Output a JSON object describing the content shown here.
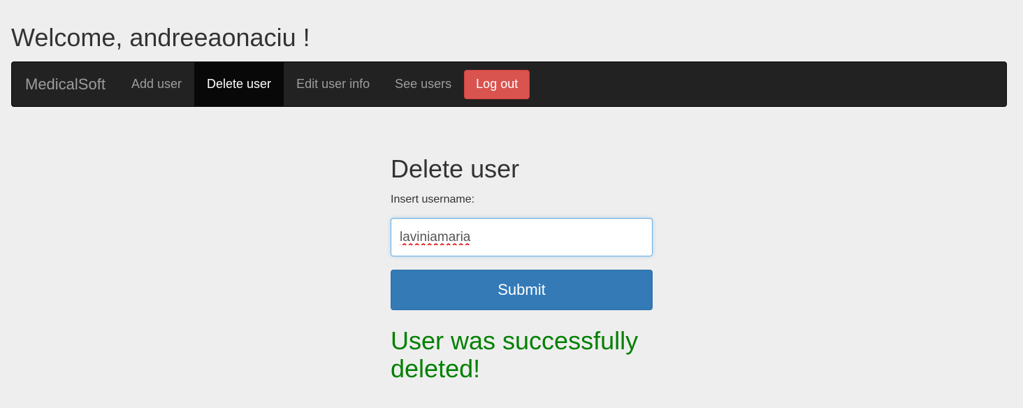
{
  "header": {
    "welcome_text": "Welcome, andreeaonaciu !"
  },
  "navbar": {
    "brand": "MedicalSoft",
    "items": [
      {
        "label": "Add user",
        "active": false
      },
      {
        "label": "Delete user",
        "active": true
      },
      {
        "label": "Edit user info",
        "active": false
      },
      {
        "label": "See users",
        "active": false
      }
    ],
    "logout_label": "Log out"
  },
  "form": {
    "title": "Delete user",
    "username_label": "Insert username:",
    "username_value": "laviniamaria",
    "submit_label": "Submit",
    "success_message": "User was successfully deleted!"
  },
  "colors": {
    "navbar_bg": "#222222",
    "active_nav_bg": "#080808",
    "logout_red": "#d9534f",
    "submit_blue": "#337ab7",
    "success_green": "#008000",
    "page_bg": "#eeeeee"
  }
}
